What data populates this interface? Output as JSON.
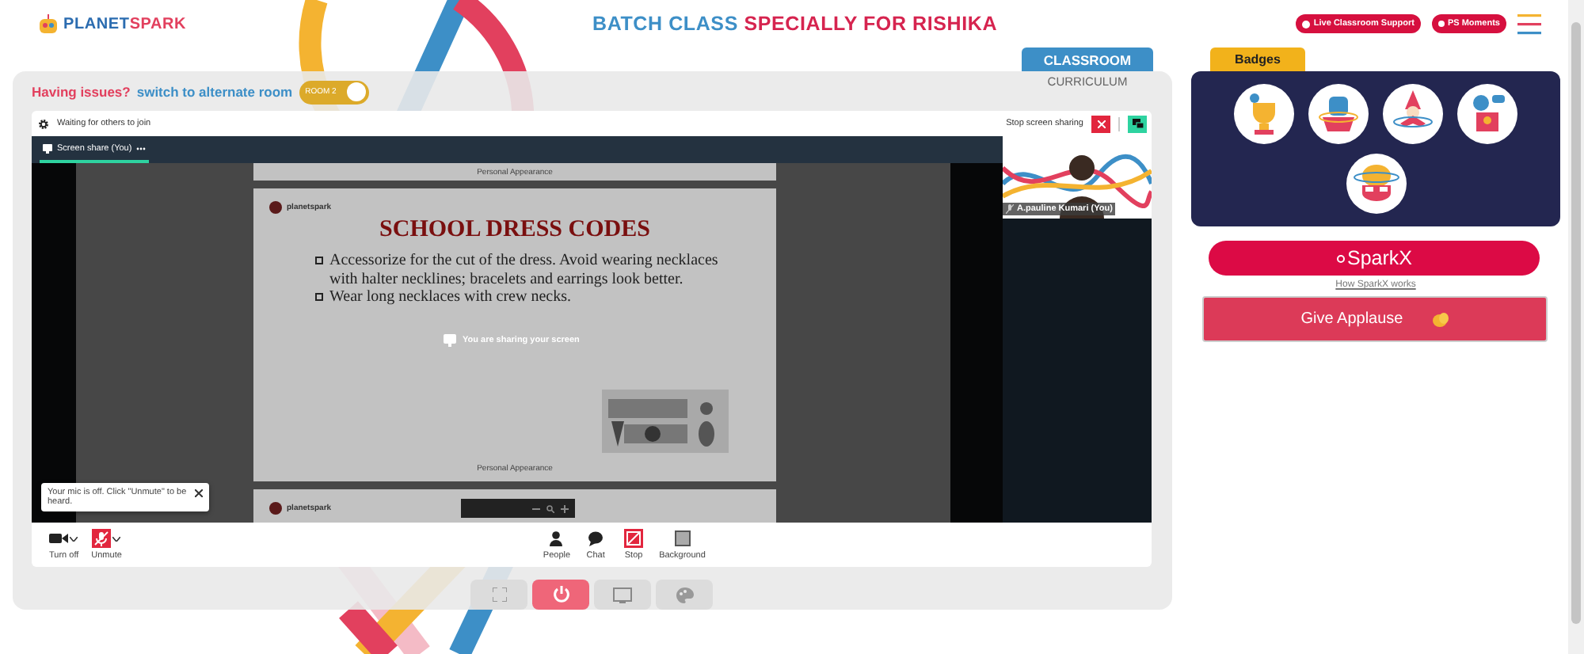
{
  "header": {
    "logo": [
      "PLANET",
      "SPARK"
    ],
    "title": [
      "BATCH CLASS",
      "SPECIALLY FOR RISHIKA"
    ],
    "actions": [
      {
        "kind": "support",
        "label": "Live Classroom Support"
      },
      {
        "kind": "moments",
        "label": "PS Moments"
      }
    ]
  },
  "tabs": [
    {
      "label": "CLASSROOM",
      "selected": true
    },
    {
      "label": "CURRICULUM",
      "selected": false
    }
  ],
  "issue_bar": {
    "prompt": "Having issues?",
    "link": "switch to alternate room",
    "toggle": {
      "label": "ROOM 2",
      "on": true
    }
  },
  "meeting": {
    "status": "Waiting for others to join",
    "stop_sharing": "Stop screen sharing",
    "share_tab": "Screen share (You)",
    "slides": [
      {
        "kind": "tail",
        "footer": "Personal Appearance"
      },
      {
        "kind": "full",
        "brand": "planetspark",
        "title": "SCHOOL DRESS CODES",
        "bullets": [
          "Accessorize for the cut of the dress. Avoid wearing necklaces with halter necklines; bracelets and earrings look better.",
          "Wear long necklaces with crew necks."
        ],
        "footer": "Personal Appearance"
      },
      {
        "kind": "head",
        "brand": "planetspark"
      }
    ],
    "sharing_notice": "You are sharing your screen",
    "participant": "A.pauline Kumari (You)",
    "mic_tip": "Your mic is off. Click \"Unmute\" to be heard.",
    "left_controls": [
      {
        "kind": "camera",
        "label": "Turn off"
      },
      {
        "kind": "mic",
        "label": "Unmute"
      }
    ],
    "right_controls": [
      {
        "kind": "people",
        "label": "People"
      },
      {
        "kind": "chat",
        "label": "Chat"
      },
      {
        "kind": "stop",
        "label": "Stop"
      },
      {
        "kind": "background",
        "label": "Background"
      }
    ]
  },
  "room_buttons": [
    {
      "kind": "fullscreen",
      "selected": false
    },
    {
      "kind": "power",
      "selected": true
    },
    {
      "kind": "screen",
      "selected": false
    },
    {
      "kind": "palette",
      "selected": false
    }
  ],
  "badges": {
    "title": "Badges",
    "items": [
      {
        "kind": "trophy"
      },
      {
        "kind": "fist"
      },
      {
        "kind": "wizard"
      },
      {
        "kind": "podium"
      },
      {
        "kind": "brain"
      }
    ]
  },
  "sparkx": {
    "label": "SparkX",
    "link": "How SparkX works"
  },
  "applause": "Give Applause"
}
